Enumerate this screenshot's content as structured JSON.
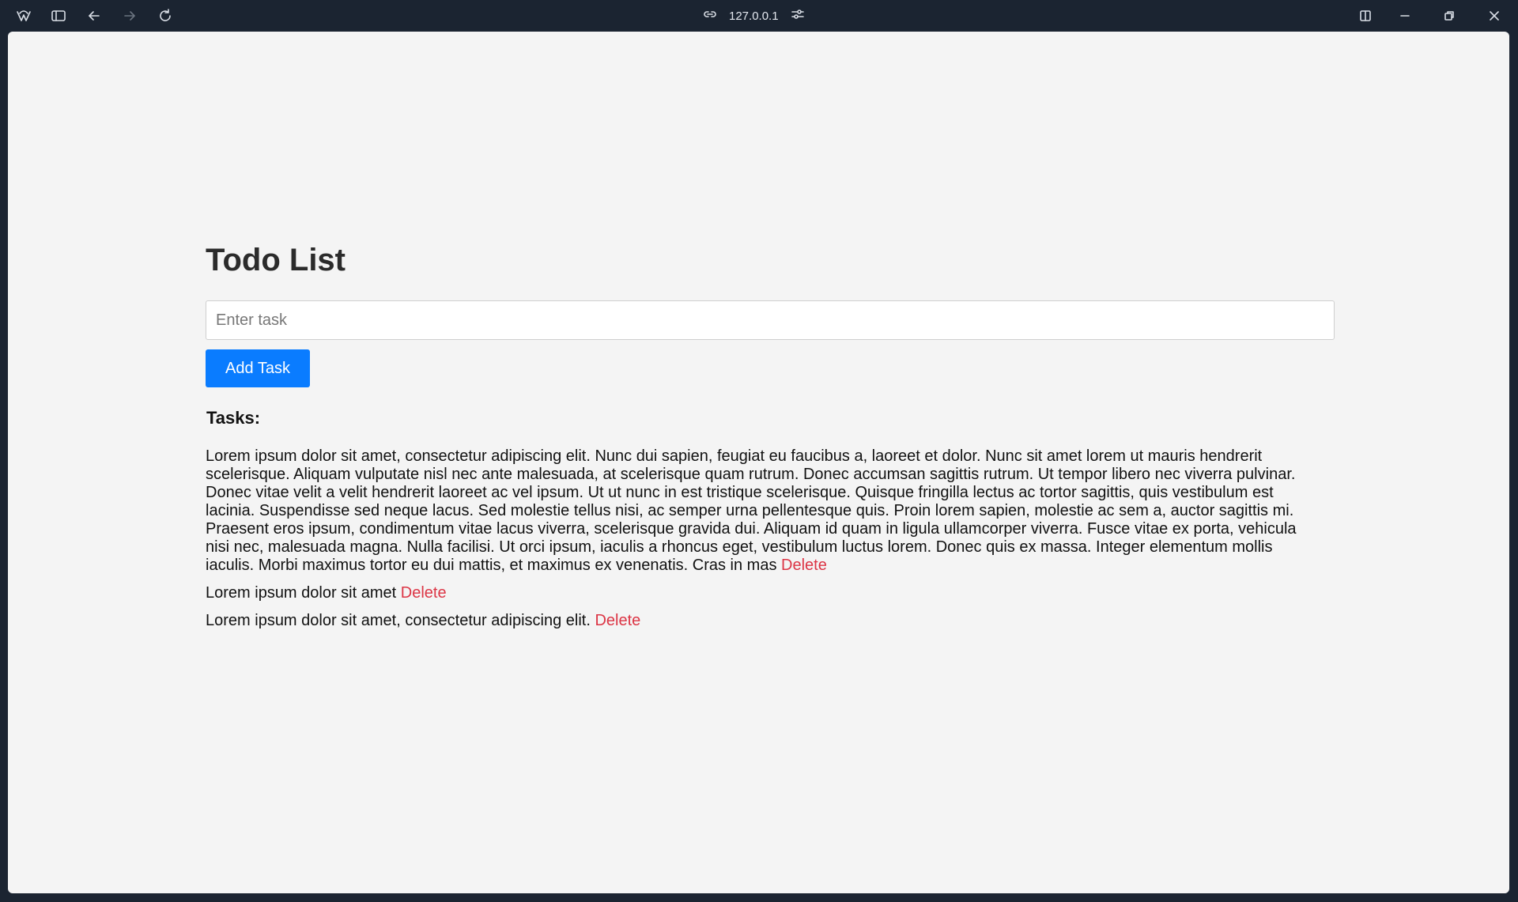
{
  "browser": {
    "url": "127.0.0.1",
    "icons": {
      "app": "browser-logo-icon",
      "sidebar": "sidebar-toggle-icon",
      "back": "back-arrow-icon",
      "forward": "forward-arrow-icon",
      "reload": "reload-icon",
      "link": "link-icon",
      "site_settings": "sliders-icon",
      "split_view": "split-view-icon",
      "minimize": "minimize-icon",
      "restore": "restore-icon",
      "close": "close-icon"
    }
  },
  "page": {
    "title": "Todo List",
    "input_placeholder": "Enter task",
    "add_button_label": "Add Task",
    "tasks_heading": "Tasks:",
    "delete_label": "Delete",
    "accent_color": "#0a7cff",
    "delete_color": "#dc3545",
    "tasks": [
      {
        "text": "Lorem ipsum dolor sit amet, consectetur adipiscing elit. Nunc dui sapien, feugiat eu faucibus a, laoreet et dolor. Nunc sit amet lorem ut mauris hendrerit scelerisque. Aliquam vulputate nisl nec ante malesuada, at scelerisque quam rutrum. Donec accumsan sagittis rutrum. Ut tempor libero nec viverra pulvinar. Donec vitae velit a velit hendrerit laoreet ac vel ipsum. Ut ut nunc in est tristique scelerisque. Quisque fringilla lectus ac tortor sagittis, quis vestibulum est lacinia. Suspendisse sed neque lacus. Sed molestie tellus nisi, ac semper urna pellentesque quis. Proin lorem sapien, molestie ac sem a, auctor sagittis mi. Praesent eros ipsum, condimentum vitae lacus viverra, scelerisque gravida dui. Aliquam id quam in ligula ullamcorper viverra. Fusce vitae ex porta, vehicula nisi nec, malesuada magna. Nulla facilisi. Ut orci ipsum, iaculis a rhoncus eget, vestibulum luctus lorem. Donec quis ex massa. Integer elementum mollis iaculis. Morbi maximus tortor eu dui mattis, et maximus ex venenatis. Cras in mas"
      },
      {
        "text": "Lorem ipsum dolor sit amet"
      },
      {
        "text": "Lorem ipsum dolor sit amet, consectetur adipiscing elit."
      }
    ]
  }
}
